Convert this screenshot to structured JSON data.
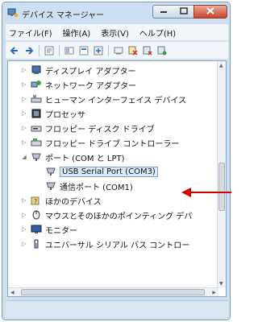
{
  "window": {
    "title": "デバイス マネージャー"
  },
  "menu": [
    {
      "label": "ファイル(F)"
    },
    {
      "label": "操作(A)"
    },
    {
      "label": "表示(V)"
    },
    {
      "label": "ヘルプ(H)"
    }
  ],
  "toolbar": {
    "icons": [
      "back-icon",
      "forward-icon",
      "properties-icon",
      "show-hide-icon",
      "help-icon",
      "update-driver-icon",
      "scan-hardware-icon",
      "uninstall-icon",
      "disable-icon",
      "enable-icon"
    ]
  },
  "tree": {
    "items": [
      {
        "label": "ディスプレイ アダプター",
        "icon": "display-adapter-icon"
      },
      {
        "label": "ネットワーク アダプター",
        "icon": "network-adapter-icon"
      },
      {
        "label": "ヒューマン インターフェイス デバイス",
        "icon": "hid-icon"
      },
      {
        "label": "プロセッサ",
        "icon": "processor-icon"
      },
      {
        "label": "フロッピー ディスク ドライブ",
        "icon": "floppy-drive-icon"
      },
      {
        "label": "フロッピー ドライブ コントローラー",
        "icon": "floppy-controller-icon"
      },
      {
        "label": "ポート (COM と LPT)",
        "icon": "port-icon"
      },
      {
        "label": "USB Serial Port (COM3)",
        "icon": "port-icon"
      },
      {
        "label": "通信ポート (COM1)",
        "icon": "port-icon"
      },
      {
        "label": "ほかのデバイス",
        "icon": "other-devices-icon"
      },
      {
        "label": "マウスとそのほかのポインティング デバ",
        "icon": "mouse-icon"
      },
      {
        "label": "モニター",
        "icon": "monitor-icon"
      },
      {
        "label": "ユニバーサル シリアル バス コントロー",
        "icon": "usb-controller-icon"
      }
    ]
  },
  "colors": {
    "annotation_arrow": "#d10000",
    "selection": "#d9e8fb"
  }
}
